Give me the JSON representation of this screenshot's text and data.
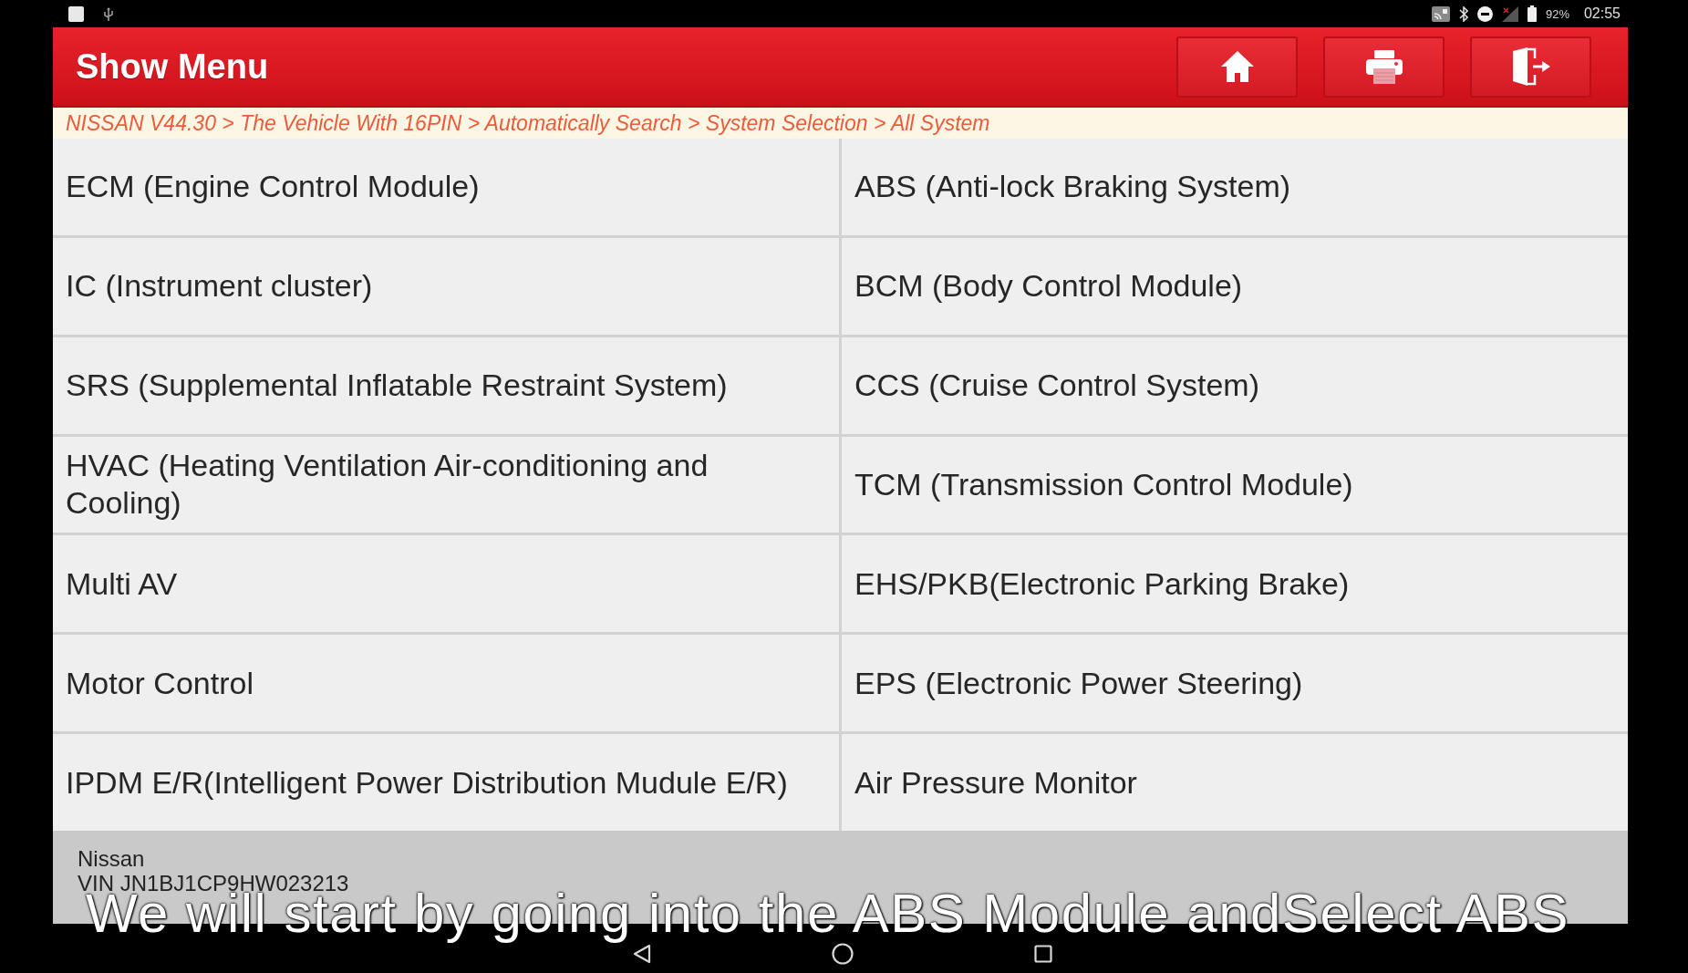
{
  "status_bar": {
    "battery": "92%",
    "time": "02:55"
  },
  "header": {
    "title": "Show Menu",
    "buttons": [
      {
        "kind": "home"
      },
      {
        "kind": "print"
      },
      {
        "kind": "exit"
      }
    ]
  },
  "breadcrumb": "NISSAN V44.30 > The Vehicle With 16PIN > Automatically Search > System Selection > All System",
  "systems": [
    "ECM (Engine Control Module)",
    "ABS (Anti-lock Braking System)",
    "IC (Instrument cluster)",
    "BCM (Body Control Module)",
    "SRS (Supplemental Inflatable Restraint System)",
    "CCS (Cruise Control System)",
    "HVAC (Heating Ventilation Air-conditioning and Cooling)",
    "TCM (Transmission Control Module)",
    "Multi AV",
    "EHS/PKB(Electronic Parking Brake)",
    "Motor Control",
    "EPS (Electronic Power Steering)",
    "IPDM E/R(Intelligent Power Distribution Mudule E/R)",
    "Air Pressure Monitor"
  ],
  "footer": {
    "make": "Nissan",
    "vin": "VIN JN1BJ1CP9HW023213"
  },
  "caption": "We will start by going into the ABS Module andSelect ABS",
  "nav_bar": {
    "buttons": [
      {
        "kind": "back"
      },
      {
        "kind": "home"
      },
      {
        "kind": "recents"
      }
    ]
  }
}
